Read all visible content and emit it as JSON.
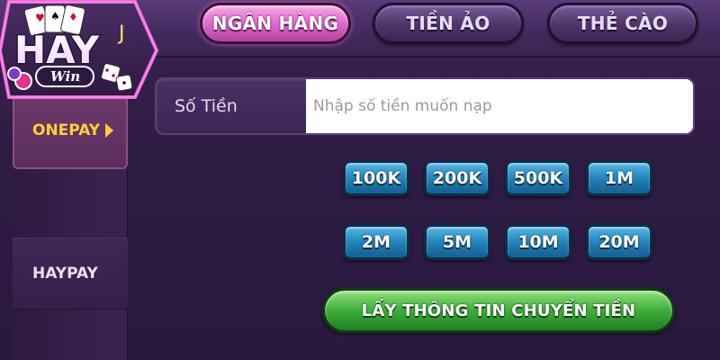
{
  "header": {
    "tabs": [
      {
        "label": "NGÂN HÀNG",
        "active": true
      },
      {
        "label": "TIỀN ẢO",
        "active": false
      },
      {
        "label": "THẺ CÀO",
        "active": false
      }
    ]
  },
  "logo": {
    "text_main": "HAY",
    "text_sub": "Win",
    "icon": "cards-dice-logo-icon"
  },
  "sidebar": {
    "items": [
      {
        "label": "ONEPAY",
        "active": true
      },
      {
        "label": "HAYPAY",
        "active": false
      }
    ]
  },
  "form": {
    "amount_label": "Số Tiền",
    "amount_placeholder": "Nhập số tiền muốn nạp",
    "amount_value": ""
  },
  "quick_amounts": [
    "100K",
    "200K",
    "500K",
    "1M",
    "2M",
    "5M",
    "10M",
    "20M"
  ],
  "cta": {
    "label": "LẤY THÔNG TIN CHUYỂN TIỀN"
  },
  "colors": {
    "active_tab": "#e26fd0",
    "amount_button": "#1f7fb8",
    "cta_button": "#3eae3a",
    "sidebar_active_text": "#ffce3a",
    "logo_glow": "#e85bd6"
  }
}
